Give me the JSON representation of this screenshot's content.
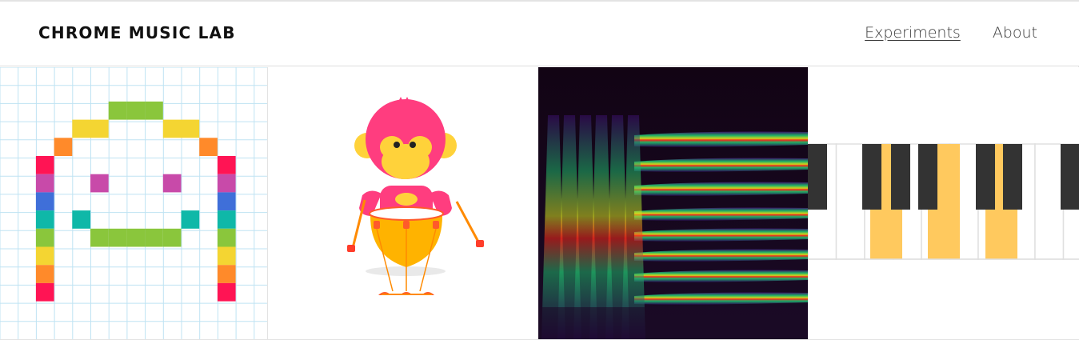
{
  "header": {
    "brand": "CHROME MUSIC LAB",
    "nav": [
      {
        "label": "Experiments",
        "active": true
      },
      {
        "label": "About",
        "active": false
      }
    ]
  },
  "tiles": [
    {
      "icon": "song-maker-grid-icon"
    },
    {
      "icon": "rhythm-monkey-drummer-icon"
    },
    {
      "icon": "spectrogram-icon"
    },
    {
      "icon": "piano-keys-icon"
    }
  ],
  "colors": {
    "grid_line": "#bfe3f3",
    "rainbow": [
      "#ff1454",
      "#ff8a2a",
      "#f4d532",
      "#8ac63c",
      "#0fb8a8",
      "#3f6fd9",
      "#c84aa9"
    ],
    "monkey_pink": "#ff3d7f",
    "monkey_yellow": "#ffd23a",
    "drum_orange": "#ffb300",
    "piano_black": "#333333",
    "piano_highlight": "#ffc95e"
  }
}
